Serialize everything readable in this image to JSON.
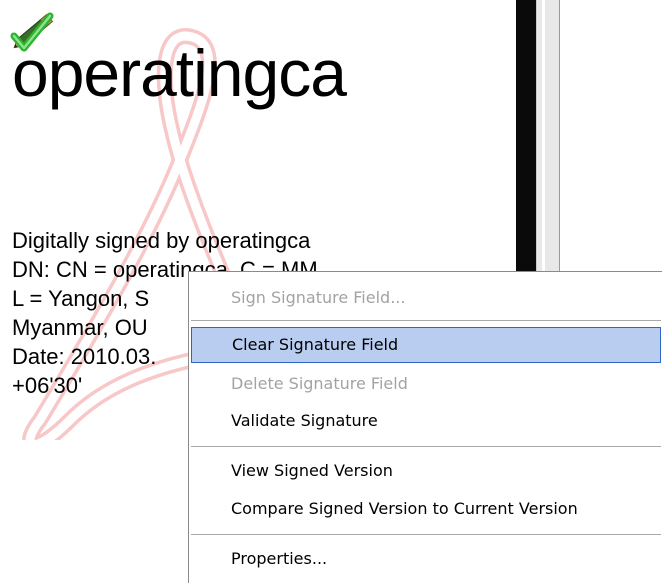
{
  "signature": {
    "name": "operatingca",
    "details_lines": [
      "Digitally signed by operatingca",
      "DN: CN = operatingca, C = MM,",
      "L = Yangon, S",
      "Myanmar, OU",
      "Date: 2010.03.",
      "+06'30'"
    ],
    "icon": "pen-checkmark-icon",
    "watermark": "acrobat-logo-watermark"
  },
  "context_menu": {
    "items": [
      {
        "label": "Sign Signature Field...",
        "enabled": false,
        "highlighted": false
      },
      {
        "label": "Clear Signature Field",
        "enabled": true,
        "highlighted": true
      },
      {
        "label": "Delete Signature Field",
        "enabled": false,
        "highlighted": false
      },
      {
        "label": "Validate Signature",
        "enabled": true,
        "highlighted": false
      },
      {
        "label": "View Signed Version",
        "enabled": true,
        "highlighted": false
      },
      {
        "label": "Compare Signed Version to Current Version",
        "enabled": true,
        "highlighted": false
      },
      {
        "label": "Properties...",
        "enabled": true,
        "highlighted": false
      }
    ]
  },
  "colors": {
    "highlight_bg": "#b9cdf0",
    "highlight_border": "#3165c5",
    "disabled_text": "#a3a3a3",
    "watermark": "#f2a0a0"
  }
}
